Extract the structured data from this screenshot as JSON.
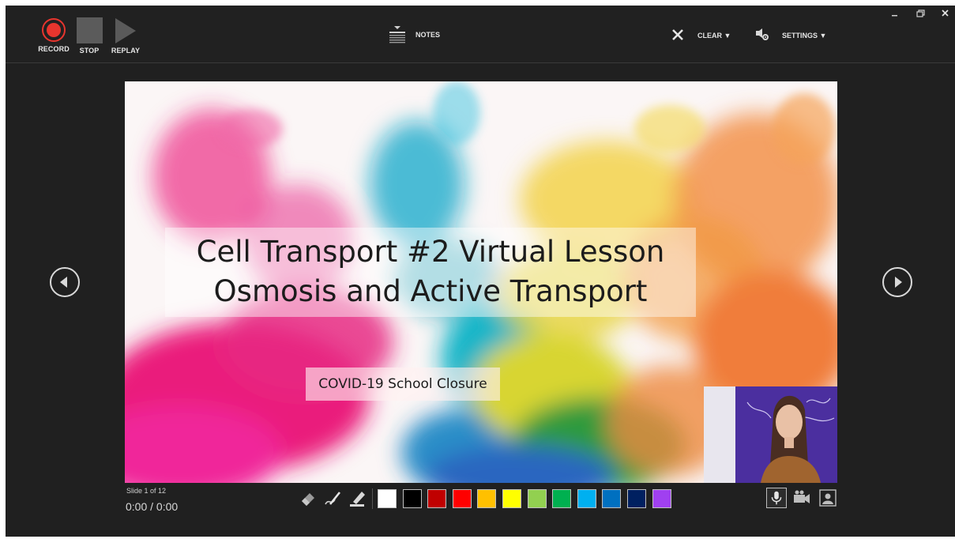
{
  "toolbar": {
    "record_label": "RECORD",
    "stop_label": "STOP",
    "replay_label": "REPLAY",
    "notes_label": "NOTES",
    "clear_label": "CLEAR ▼",
    "settings_label": "SETTINGS ▼"
  },
  "window_controls": [
    "minimize-icon",
    "restore-icon",
    "close-icon"
  ],
  "slide": {
    "title_line1": "Cell Transport #2 Virtual Lesson",
    "title_line2": "Osmosis and Active Transport",
    "subtitle": "COVID-19 School Closure"
  },
  "status": {
    "slide_count": "Slide 1 of 12",
    "timer": "0:00 / 0:00"
  },
  "ink_tools": [
    "eraser-icon",
    "pen-icon",
    "highlighter-icon"
  ],
  "colors": {
    "record_red": "#e8352e",
    "background": "#202020",
    "swatches": [
      "#ffffff",
      "#000000",
      "#c00000",
      "#ff0000",
      "#ffc000",
      "#ffff00",
      "#92d050",
      "#00b050",
      "#00b0f0",
      "#0070c0",
      "#002060",
      "#a040f0"
    ]
  },
  "media_controls": [
    "microphone-icon",
    "camera-icon",
    "camera-preview-icon"
  ]
}
